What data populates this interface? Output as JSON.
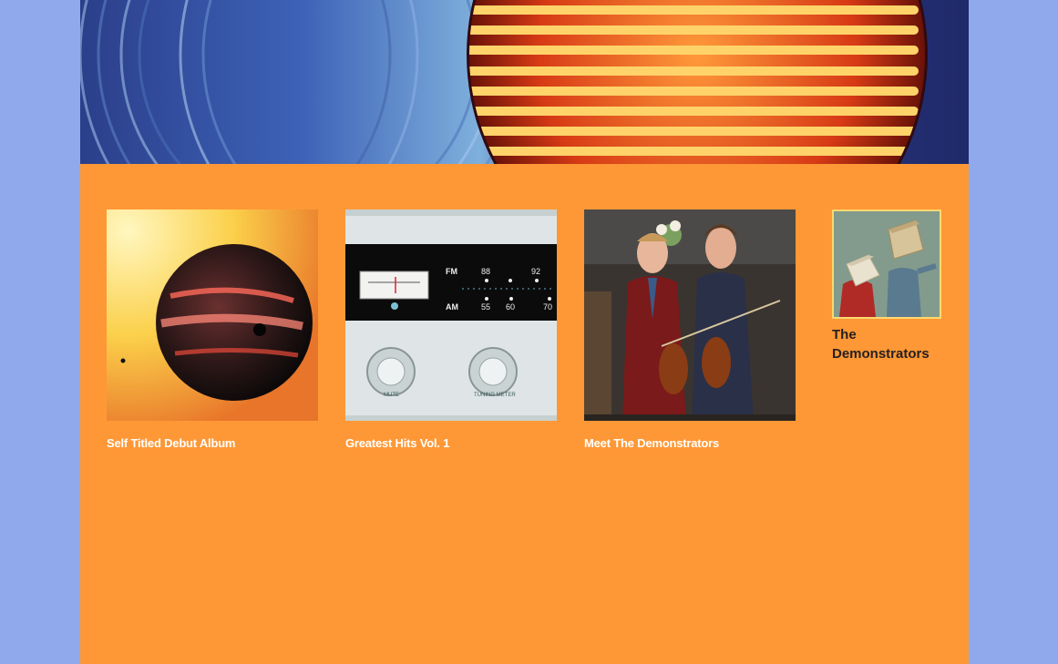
{
  "header": {
    "banner_image": "vinyl-records-and-heater-banner"
  },
  "albums": [
    {
      "title": "Self Titled Debut Album",
      "cover": "planet-eclipse-cover"
    },
    {
      "title": "Greatest Hits Vol. 1",
      "cover": "radio-dial-cover",
      "radio": {
        "fm_label": "FM",
        "am_label": "AM",
        "fm_ticks": [
          "88",
          "92"
        ],
        "am_ticks": [
          "55",
          "60",
          "70"
        ],
        "knob_labels": [
          "MUTE",
          "TUNING METER"
        ]
      }
    },
    {
      "title": "Meet The Demonstrators",
      "cover": "two-violinists-cover"
    }
  ],
  "artist": {
    "name": "The Demonstrators",
    "thumbnail": "box-head-figures-photo"
  },
  "colors": {
    "page_background": "#8fa9ec",
    "content_background": "#fe9836",
    "album_title": "#ffffff",
    "artist_name": "#262020"
  }
}
